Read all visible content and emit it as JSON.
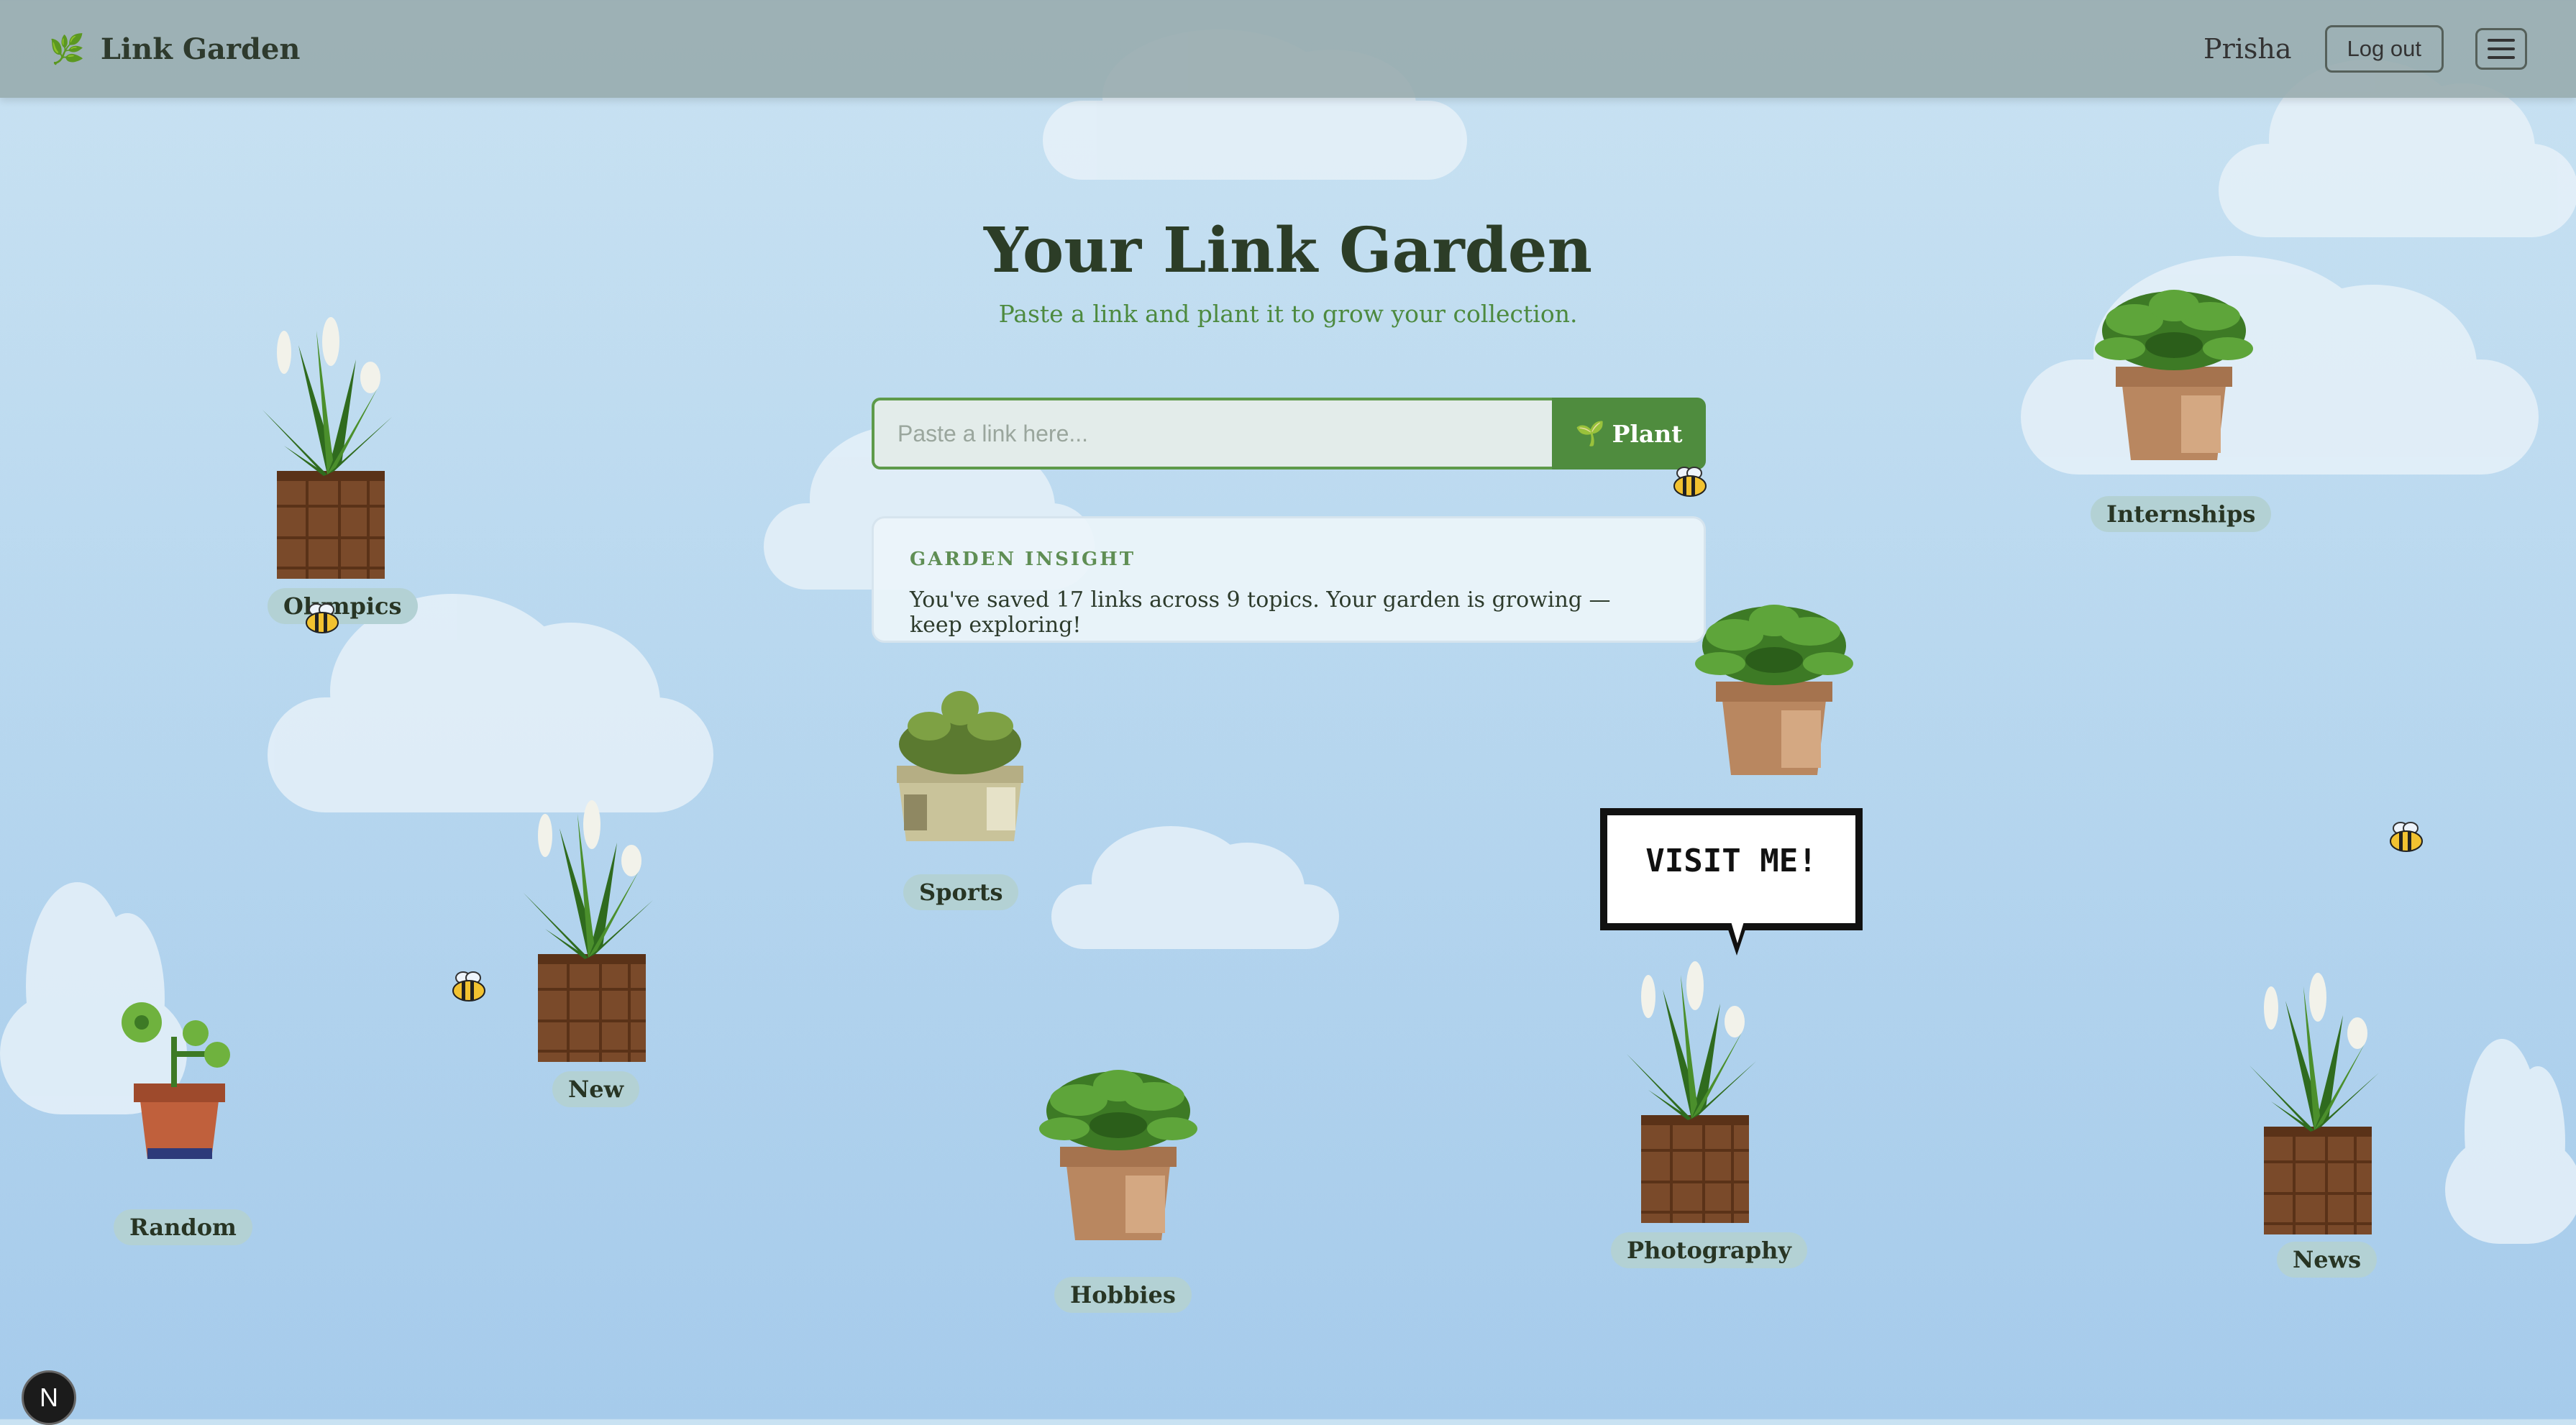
{
  "header": {
    "app_title": "Link Garden",
    "user_name": "Prisha",
    "logout_label": "Log out"
  },
  "main": {
    "title": "Your Link Garden",
    "subtitle": "Paste a link and plant it to grow your collection.",
    "search": {
      "placeholder": "Paste a link here...",
      "button_label": "Plant"
    },
    "insight": {
      "label": "GARDEN INSIGHT",
      "text": "You've saved 17 links across 9 topics. Your garden is growing — keep exploring!"
    }
  },
  "plants": [
    {
      "label": "Olympics",
      "kind": "lily"
    },
    {
      "label": "Internships",
      "kind": "leafy"
    },
    {
      "label": "Sports",
      "kind": "succulent"
    },
    {
      "label": "",
      "kind": "leafy"
    },
    {
      "label": "New",
      "kind": "lily"
    },
    {
      "label": "Random",
      "kind": "sprout"
    },
    {
      "label": "Hobbies",
      "kind": "leafy"
    },
    {
      "label": "Photography",
      "kind": "lily"
    },
    {
      "label": "News",
      "kind": "lily"
    }
  ],
  "bubble": {
    "text": "VISIT ME!"
  },
  "dev_badge": "N",
  "colors": {
    "accent": "#4f8c3e",
    "header_bg": "#9aaeae",
    "sky": "#b9d8ef"
  }
}
